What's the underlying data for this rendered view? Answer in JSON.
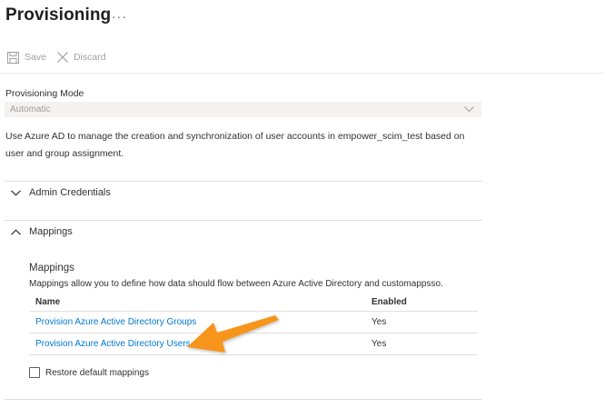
{
  "page": {
    "title": "Provisioning",
    "more_label": "···"
  },
  "toolbar": {
    "save_label": "Save",
    "discard_label": "Discard"
  },
  "provisioning_mode": {
    "label": "Provisioning Mode",
    "value": "Automatic"
  },
  "description": "Use Azure AD to manage the creation and synchronization of user accounts in empower_scim_test based on user and group assignment.",
  "sections": {
    "admin_credentials": {
      "label": "Admin Credentials",
      "expanded": false
    },
    "mappings": {
      "label": "Mappings",
      "expanded": true
    }
  },
  "mappings": {
    "title": "Mappings",
    "description": "Mappings allow you to define how data should flow between Azure Active Directory and customappsso.",
    "columns": {
      "name": "Name",
      "enabled": "Enabled"
    },
    "rows": [
      {
        "name": "Provision Azure Active Directory Groups",
        "enabled": "Yes"
      },
      {
        "name": "Provision Azure Active Directory Users",
        "enabled": "Yes"
      }
    ],
    "restore_label": "Restore default mappings"
  },
  "colors": {
    "accent": "#0078d4",
    "arrow": "#f7941d",
    "disabled_text": "#a19f9d"
  },
  "icons": {
    "save": "save-icon",
    "discard": "close-icon",
    "collapsed": "chevron-down-icon",
    "expanded": "chevron-up-icon",
    "annotation": "arrow-annotation"
  }
}
